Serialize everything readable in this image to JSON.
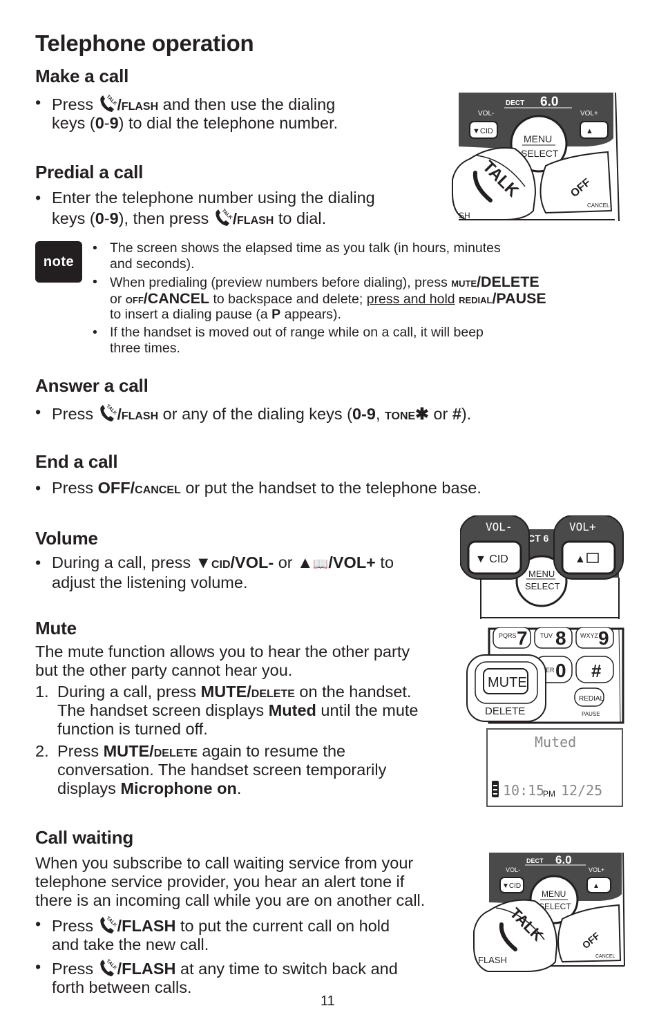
{
  "page": {
    "title": "Telephone operation",
    "page_number": "11"
  },
  "make_call": {
    "heading": "Make a call",
    "bullet": {
      "pre": "Press ",
      "key": "/FLASH",
      "line1_rest": " and then use the dialing",
      "line2_a": "keys (",
      "line2_b": "0",
      "line2_c": "-",
      "line2_d": "9",
      "line2_e": ") to dial the telephone number."
    }
  },
  "predial_call": {
    "heading": "Predial a call",
    "bullet": {
      "line1": "Enter the telephone number using the dialing",
      "line2_a": "keys (",
      "line2_b": "0",
      "line2_c": "-",
      "line2_d": "9",
      "line2_e": "), then press ",
      "key": "/FLASH",
      "line2_f": " to dial."
    }
  },
  "note": {
    "label": "note",
    "items": [
      {
        "l1": "The screen shows the elapsed time as you talk (in hours, minutes",
        "l2": "and seconds)."
      },
      {
        "l1_a": "When predialing (preview numbers before dialing), press ",
        "l1_key1sc": "MUTE",
        "l1_key1": "/DELETE",
        "l2_a": "or ",
        "l2_key2sc": "OFF",
        "l2_key2": "/CANCEL",
        "l2_b": " to backspace and delete; ",
        "l2_ul": "press and hold",
        "l2_c": " ",
        "l2_key3sc": "REDIAL",
        "l2_key3": "/PAUSE",
        "l3_a": "to insert a dialing pause (a ",
        "l3_b": "P",
        "l3_c": " appears)."
      },
      {
        "l1": "If the handset is moved out of range while on a call, it will beep",
        "l2": "three times."
      }
    ]
  },
  "answer_call": {
    "heading": "Answer a call",
    "bullet": {
      "pre": "Press ",
      "key": "/FLASH",
      "a": " or any of the dialing keys (",
      "b": "0-9",
      "c": ", ",
      "d": "TONE",
      "e": "✱",
      "f": " or ",
      "g": "#",
      "h": ")."
    }
  },
  "end_call": {
    "heading": "End a call",
    "bullet": {
      "pre": "Press ",
      "key": "OFF/",
      "keysc": "CANCEL",
      "rest": " or put the handset to the telephone base."
    }
  },
  "volume": {
    "heading": "Volume",
    "bullet": {
      "a": "During a call, press ",
      "down": "▼",
      "cid": "CID",
      "vol_minus": "/VOL-",
      "or": " or ",
      "up": "▲",
      "book": "📖",
      "vol_plus": "/VOL+",
      "to": " to",
      "line2": "adjust the listening volume."
    }
  },
  "mute": {
    "heading": "Mute",
    "intro_l1": "The mute function allows you to hear the other party",
    "intro_l2": "but the other party cannot hear you.",
    "steps": [
      {
        "n": "1.",
        "l1_a": "During a call, press ",
        "l1_b": "MUTE/",
        "l1_c": "DELETE",
        "l1_d": " on the handset.",
        "l2_a": "The handset screen displays ",
        "l2_b": "Muted",
        "l2_c": " until the mute",
        "l3": "function is turned off."
      },
      {
        "n": "2.",
        "l1_a": "Press ",
        "l1_b": "MUTE/",
        "l1_c": "DELETE",
        "l1_d": " again to resume the",
        "l2": "conversation. The handset screen temporarily",
        "l3_a": "displays ",
        "l3_b": "Microphone on",
        "l3_c": "."
      }
    ]
  },
  "call_waiting": {
    "heading": "Call waiting",
    "intro": [
      "When you subscribe to call waiting service from your",
      "telephone service provider, you hear an alert tone if",
      "there is an incoming call while you are on another call."
    ],
    "bullets": [
      {
        "pre": "Press ",
        "key": "/FLASH",
        "rest": " to put the current call on hold",
        "l2": "and take the new call."
      },
      {
        "pre": "Press ",
        "key": "/FLASH",
        "rest": " at any time to switch back and",
        "l2": "forth between calls."
      }
    ]
  },
  "figures": {
    "handset_top": {
      "brand": "DECT",
      "brand_num": "6.0",
      "vol_minus": "VOL-",
      "vol_plus": "VOL+",
      "cid": "▼CID",
      "book": "▲",
      "menu": "MENU",
      "select": "SELECT",
      "talk": "TALK",
      "off": "OFF",
      "cancel": "CANCEL",
      "flash_partial": "SH"
    },
    "volume_keys": {
      "vol_minus": "VOL-",
      "vol_plus": "VOL+",
      "cid": "▼ CID",
      "book": "▲",
      "menu": "MENU",
      "select": "SELECT",
      "brand_partial": "CT 6"
    },
    "keypad": {
      "pqrs": "PQRS",
      "seven": "7",
      "tuv": "TUV",
      "eight": "8",
      "wxyz": "WXYZ",
      "nine": "9",
      "oper": "PER",
      "zero": "0",
      "hash": "#",
      "mute": "MUTE",
      "delete": "DELETE",
      "redial": "REDIAL",
      "pause": "PAUSE"
    },
    "lcd": {
      "line1": "Muted",
      "time": "10:15",
      "ampm": "PM",
      "date": "12/25"
    },
    "handset_bottom": {
      "brand": "DECT",
      "brand_num": "6.0",
      "vol_minus": "VOL-",
      "vol_plus": "VOL+",
      "cid": "▼CID",
      "book": "▲",
      "menu": "MENU",
      "select": "SELECT",
      "talk": "TALK",
      "off": "OFF",
      "cancel": "CANCEL",
      "flash": "FLASH"
    }
  }
}
